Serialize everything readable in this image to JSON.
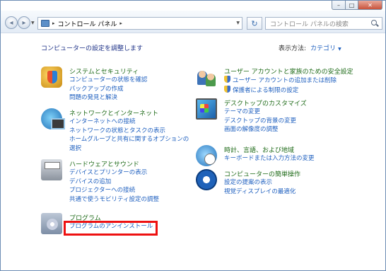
{
  "window": {
    "title_buttons": {
      "minimize": "–",
      "maximize": "□",
      "close": "✕"
    }
  },
  "navbar": {
    "back_icon": "back-arrow-icon",
    "forward_icon": "forward-arrow-icon",
    "address_separator": "▸",
    "address_path": "コントロール パネル",
    "address_trailing_separator": "▸",
    "search_placeholder": "コントロール パネルの検索"
  },
  "header": {
    "title": "コンピューターの設定を調整します",
    "view_by_label": "表示方法:",
    "view_by_value": "カテゴリ"
  },
  "categories": [
    {
      "title": "システムとセキュリティ",
      "icon": "system-security-icon",
      "links": [
        "コンピューターの状態を確認",
        "バックアップの作成",
        "問題の発見と解決"
      ]
    },
    {
      "title": "ネットワークとインターネット",
      "icon": "network-icon",
      "links": [
        "インターネットへの接続",
        "ネットワークの状態とタスクの表示",
        "ホームグループと共有に関するオプションの",
        "選択"
      ]
    },
    {
      "title": "ハードウェアとサウンド",
      "icon": "hardware-sound-icon",
      "links": [
        "デバイスとプリンターの表示",
        "デバイスの追加",
        "プロジェクターへの接続",
        "共通で使うモビリティ設定の調整"
      ]
    },
    {
      "title": "プログラム",
      "icon": "programs-icon",
      "links": [
        "プログラムのアンインストール"
      ]
    },
    {
      "title": "ユーザー アカウントと家族のための安全設定",
      "icon": "user-accounts-icon",
      "links": [
        "ユーザー アカウントの追加または削除",
        "保護者による制限の設定"
      ]
    },
    {
      "title": "デスクトップのカスタマイズ",
      "icon": "desktop-customize-icon",
      "links": [
        "テーマの変更",
        "デスクトップの背景の変更",
        "画面の解像度の調整"
      ]
    },
    {
      "title": "時計、言語、および地域",
      "icon": "clock-language-icon",
      "links": [
        "キーボードまたは入力方法の変更"
      ]
    },
    {
      "title": "コンピューターの簡単操作",
      "icon": "ease-of-access-icon",
      "links": [
        "設定の提案の表示",
        "視覚ディスプレイの最適化"
      ]
    }
  ],
  "colors": {
    "category_title": "#1f6b19",
    "link": "#1e5fbf",
    "highlight_border": "#ee1111"
  }
}
